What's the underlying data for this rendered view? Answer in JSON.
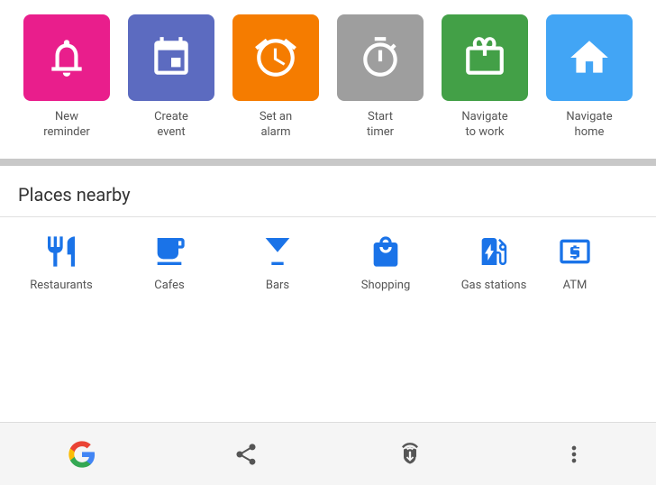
{
  "quickActions": {
    "items": [
      {
        "id": "new-reminder",
        "label": "New\nreminder",
        "labelLine1": "New",
        "labelLine2": "reminder",
        "bgClass": "bg-pink",
        "icon": "reminder"
      },
      {
        "id": "create-event",
        "label": "Create\nevent",
        "labelLine1": "Create",
        "labelLine2": "event",
        "bgClass": "bg-indigo",
        "icon": "event"
      },
      {
        "id": "set-alarm",
        "label": "Set an\nalarm",
        "labelLine1": "Set an",
        "labelLine2": "alarm",
        "bgClass": "bg-orange",
        "icon": "alarm"
      },
      {
        "id": "start-timer",
        "label": "Start\ntimer",
        "labelLine1": "Start",
        "labelLine2": "timer",
        "bgClass": "bg-gray",
        "icon": "timer"
      },
      {
        "id": "navigate-work",
        "label": "Navigate\nto work",
        "labelLine1": "Navigate",
        "labelLine2": "to work",
        "bgClass": "bg-green",
        "icon": "work"
      },
      {
        "id": "navigate-home",
        "label": "Navigate\nhome",
        "labelLine1": "Navigate",
        "labelLine2": "home",
        "bgClass": "bg-blue",
        "icon": "home"
      }
    ]
  },
  "placesNearby": {
    "title": "Places nearby",
    "items": [
      {
        "id": "restaurants",
        "label": "Restaurants",
        "icon": "restaurant"
      },
      {
        "id": "cafes",
        "label": "Cafes",
        "icon": "cafe"
      },
      {
        "id": "bars",
        "label": "Bars",
        "icon": "bar"
      },
      {
        "id": "shopping",
        "label": "Shopping",
        "icon": "shopping"
      },
      {
        "id": "gas-stations",
        "label": "Gas stations",
        "icon": "gas"
      },
      {
        "id": "atm",
        "label": "ATM",
        "icon": "atm"
      }
    ]
  },
  "bottomNav": {
    "items": [
      {
        "id": "google",
        "label": "Google"
      },
      {
        "id": "share",
        "label": "Share"
      },
      {
        "id": "touch",
        "label": "Touch"
      },
      {
        "id": "more",
        "label": "More"
      }
    ]
  }
}
